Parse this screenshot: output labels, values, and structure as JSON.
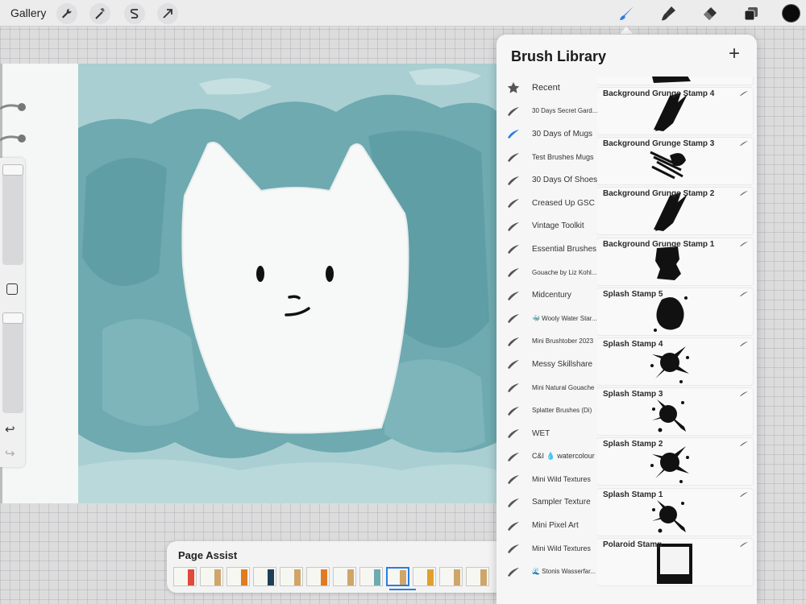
{
  "toolbar": {
    "gallery_label": "Gallery",
    "left_tools": [
      {
        "name": "wrench-icon"
      },
      {
        "name": "magic-wand-icon"
      },
      {
        "name": "selection-s-icon"
      },
      {
        "name": "transform-arrow-icon"
      }
    ],
    "right_tools": [
      {
        "name": "brush-icon",
        "active": true
      },
      {
        "name": "smudge-icon",
        "active": false
      },
      {
        "name": "eraser-icon",
        "active": false
      },
      {
        "name": "layers-icon",
        "active": false
      }
    ],
    "current_color": "#0a0a0a",
    "accent_color": "#2a7de1"
  },
  "side_panel": {
    "buttons": [
      "modify-square-button",
      "undo-button",
      "redo-button"
    ]
  },
  "page_assist": {
    "title": "Page Assist",
    "selected_page": 9,
    "page_count": 12
  },
  "brush_library": {
    "title": "Brush Library",
    "add_label": "+",
    "selected_set": "30 Days of Mugs",
    "sets": [
      {
        "label": "Recent",
        "size": 11,
        "icon": "star"
      },
      {
        "label": "30 Days Secret Gard...",
        "size": 8,
        "icon": "stroke"
      },
      {
        "label": "30 Days of Mugs",
        "size": 10,
        "icon": "stroke",
        "selected": true
      },
      {
        "label": "Test Brushes Mugs",
        "size": 9,
        "icon": "stroke"
      },
      {
        "label": "30 Days Of Shoes",
        "size": 10,
        "icon": "stroke"
      },
      {
        "label": "Creased Up GSC",
        "size": 10,
        "icon": "stroke"
      },
      {
        "label": "Vintage Toolkit",
        "size": 10,
        "icon": "stroke"
      },
      {
        "label": "Essential Brushes",
        "size": 10,
        "icon": "stroke"
      },
      {
        "label": "Gouache by Liz Kohl...",
        "size": 8,
        "icon": "stroke"
      },
      {
        "label": "Midcentury",
        "size": 10,
        "icon": "stroke"
      },
      {
        "label": "🐳 Wooly Water Star...",
        "size": 8,
        "icon": "stroke"
      },
      {
        "label": "Mini Brushtober 2023",
        "size": 8,
        "icon": "stroke"
      },
      {
        "label": "Messy Skillshare",
        "size": 10,
        "icon": "stroke"
      },
      {
        "label": "Mini Natural Gouache",
        "size": 8,
        "icon": "stroke"
      },
      {
        "label": "Splatter Brushes (Di)",
        "size": 8,
        "icon": "stroke"
      },
      {
        "label": "WET",
        "size": 10,
        "icon": "stroke"
      },
      {
        "label": "C&I 💧 watercolour",
        "size": 9,
        "icon": "stroke"
      },
      {
        "label": "Mini Wild Textures",
        "size": 9,
        "icon": "stroke"
      },
      {
        "label": "Sampler Texture",
        "size": 10,
        "icon": "stroke"
      },
      {
        "label": "Mini Pixel Art",
        "size": 10,
        "icon": "stroke"
      },
      {
        "label": "Mini Wild Textures",
        "size": 9,
        "icon": "stroke"
      },
      {
        "label": "🌊 Stonis Wasserfar...",
        "size": 8,
        "icon": "stroke"
      }
    ],
    "brushes": [
      {
        "name": "Background Grunge Stamp 4",
        "stroke": "grunge-diagonal"
      },
      {
        "name": "Background Grunge Stamp 3",
        "stroke": "grunge-streaks"
      },
      {
        "name": "Background Grunge Stamp 2",
        "stroke": "grunge-diagonal"
      },
      {
        "name": "Background Grunge Stamp 1",
        "stroke": "grunge-block"
      },
      {
        "name": "Splash Stamp 5",
        "stroke": "splash-round"
      },
      {
        "name": "Splash Stamp 4",
        "stroke": "splash-burst"
      },
      {
        "name": "Splash Stamp 3",
        "stroke": "splash-drips"
      },
      {
        "name": "Splash Stamp 2",
        "stroke": "splash-burst"
      },
      {
        "name": "Splash Stamp 1",
        "stroke": "splash-drips"
      },
      {
        "name": "Polaroid Stamp",
        "stroke": "polaroid"
      }
    ]
  }
}
